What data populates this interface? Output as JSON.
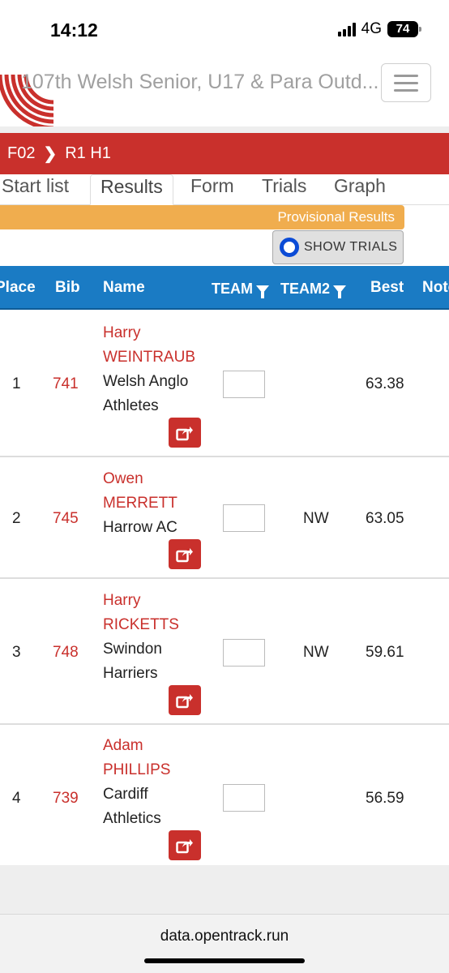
{
  "status_bar": {
    "time": "14:12",
    "network": "4G",
    "battery": "74"
  },
  "header": {
    "title": "107th Welsh Senior, U17 & Para Outd..."
  },
  "breadcrumb": {
    "event": "F02",
    "round": "R1 H1"
  },
  "tabs": [
    {
      "label": "Start list",
      "active": false
    },
    {
      "label": "Results",
      "active": true
    },
    {
      "label": "Form",
      "active": false
    },
    {
      "label": "Trials",
      "active": false
    },
    {
      "label": "Graph",
      "active": false
    }
  ],
  "banner": {
    "provisional": "Provisional Results",
    "show_trials": "SHOW TRIALS"
  },
  "table": {
    "headers": {
      "place": "Place",
      "bib": "Bib",
      "name": "Name",
      "team": "TEAM",
      "team2": "TEAM2",
      "best": "Best",
      "notes": "Notes"
    },
    "rows": [
      {
        "place": "1",
        "bib": "741",
        "first": "Harry",
        "last": "WEINTRAUB",
        "club_line1": "Welsh Anglo",
        "club_line2": "Athletes",
        "team2": "",
        "best": "63.38"
      },
      {
        "place": "2",
        "bib": "745",
        "first": "Owen",
        "last": "MERRETT",
        "club_line1": "Harrow AC",
        "club_line2": "",
        "team2": "NW",
        "best": "63.05"
      },
      {
        "place": "3",
        "bib": "748",
        "first": "Harry",
        "last": "RICKETTS",
        "club_line1": "Swindon",
        "club_line2": "Harriers",
        "team2": "NW",
        "best": "59.61"
      },
      {
        "place": "4",
        "bib": "739",
        "first": "Adam",
        "last": "PHILLIPS",
        "club_line1": "Cardiff",
        "club_line2": "Athletics",
        "team2": "",
        "best": "56.59"
      }
    ]
  },
  "browser": {
    "url": "data.opentrack.run"
  },
  "colors": {
    "brand_red": "#c9302c",
    "header_blue": "#1a7bc4",
    "warning_orange": "#f0ad4e",
    "radio_blue": "#0b4bd6"
  }
}
